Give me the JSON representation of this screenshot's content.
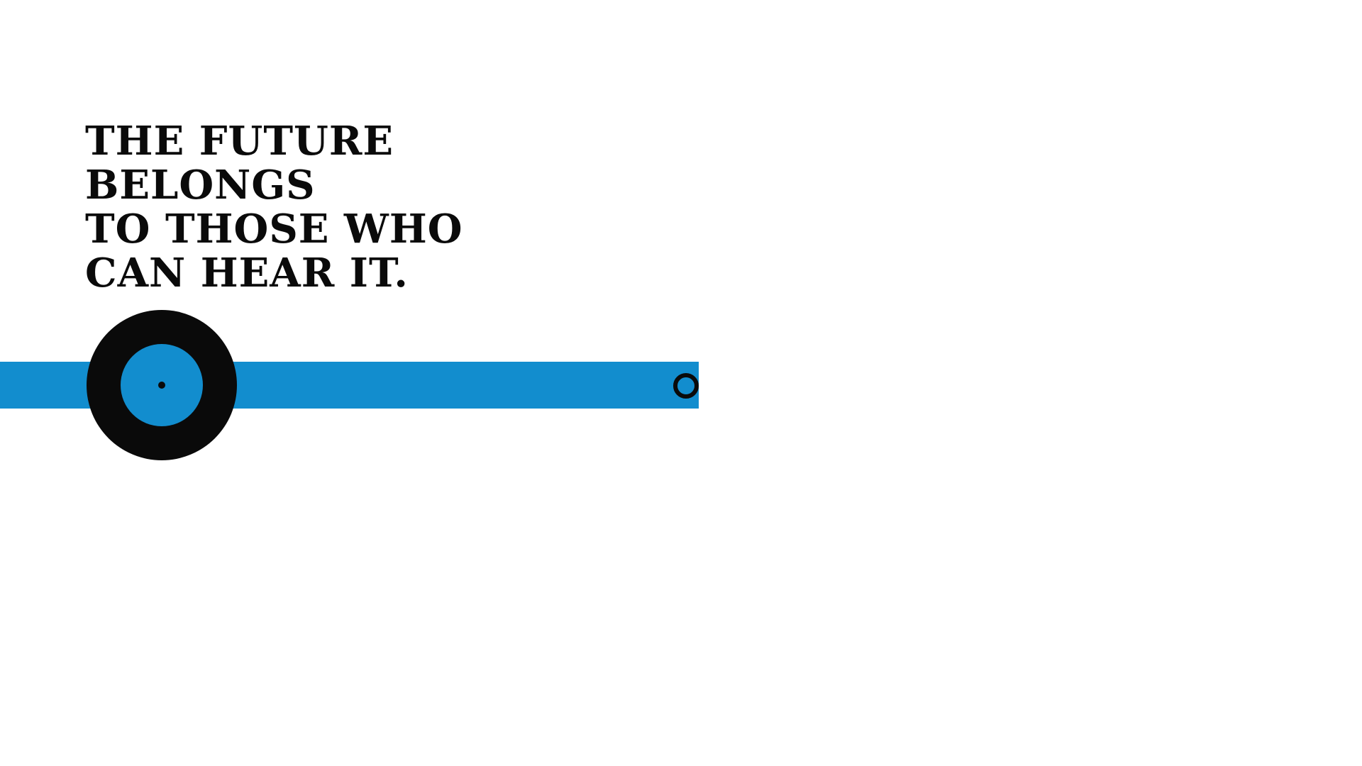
{
  "headline": {
    "lines": [
      "THE FUTURE",
      "BELONGS",
      "TO THOSE WHO",
      "CAN HEAR IT."
    ]
  },
  "colors": {
    "accent_blue": "#128dce",
    "ink_black": "#0a0a0a",
    "background": "#ffffff"
  },
  "graphic": {
    "disc_icon": "vinyl-record-icon",
    "end_icon": "ring-knob-icon"
  }
}
